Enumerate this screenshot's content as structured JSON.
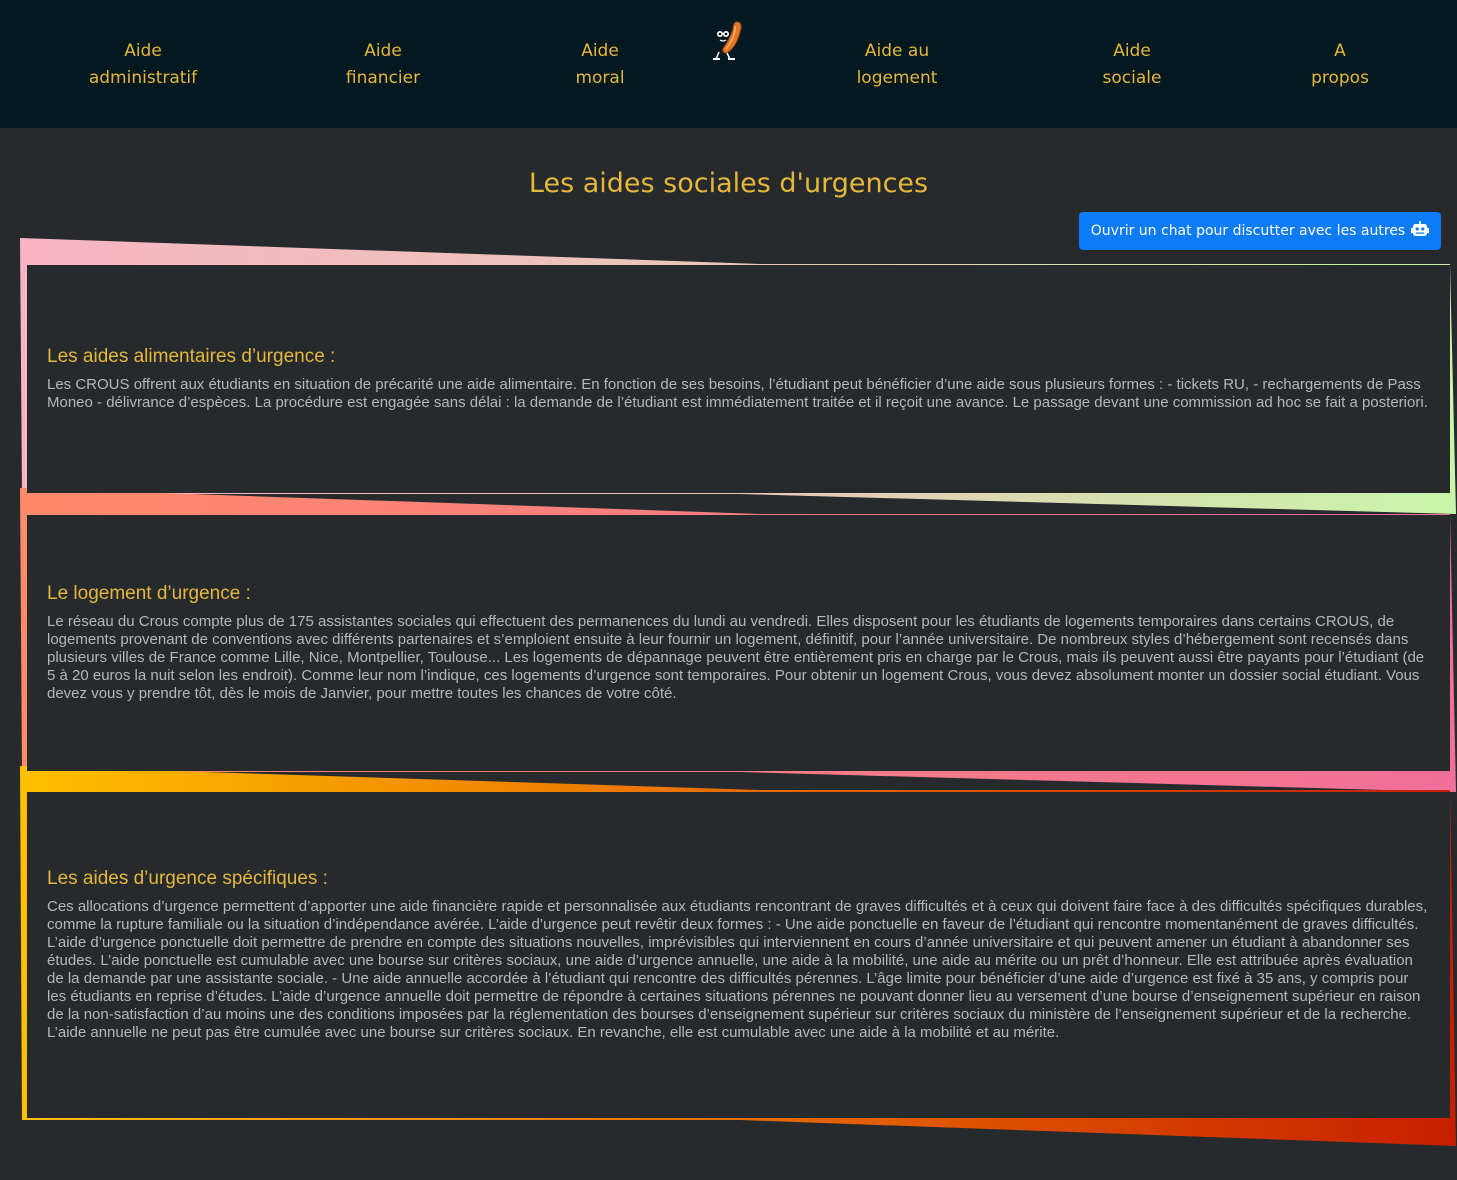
{
  "nav": {
    "items": [
      {
        "line1": "Aide",
        "line2": "administratif"
      },
      {
        "line1": "Aide",
        "line2": "financier"
      },
      {
        "line1": "Aide",
        "line2": "moral"
      },
      {
        "line1": "Aide au",
        "line2": "logement"
      },
      {
        "line1": "Aide",
        "line2": "sociale"
      },
      {
        "line1": "A",
        "line2": "propos"
      }
    ],
    "logo_icon": "sausage-mascot-icon"
  },
  "main": {
    "title": "Les aides sociales d'urgences",
    "chat_button_label": "Ouvrir un chat pour discutter avec les autres",
    "chat_button_icon": "robot-icon",
    "sections": [
      {
        "heading": "Les aides alimentaires d’urgence :",
        "text": "Les CROUS offrent aux étudiants en situation de précarité une aide alimentaire. En fonction de ses besoins, l’étudiant peut bénéficier d’une aide sous plusieurs formes : - tickets RU, - rechargements de Pass Moneo - délivrance d’espèces. La procédure est engagée sans délai : la demande de l’étudiant est immédiatement traitée et il reçoit une avance. Le passage devant une commission ad hoc se fait a posteriori."
      },
      {
        "heading": "Le logement d’urgence :",
        "text": "Le réseau du Crous compte plus de 175 assistantes sociales qui effectuent des permanences du lundi au vendredi. Elles disposent pour les étudiants de logements temporaires dans certains CROUS, de logements provenant de conventions avec différents partenaires et s’emploient ensuite à leur fournir un logement, définitif, pour l’année universitaire. De nombreux styles d’hébergement sont recensés dans plusieurs villes de France comme Lille, Nice, Montpellier, Toulouse... Les logements de dépannage peuvent être entièrement pris en charge par le Crous, mais ils peuvent aussi être payants pour l’étudiant (de 5 à 20 euros la nuit selon les endroit). Comme leur nom l’indique, ces logements d’urgence sont temporaires. Pour obtenir un logement Crous, vous devez absolument monter un dossier social étudiant. Vous devez vous y prendre tôt, dès le mois de Janvier, pour mettre toutes les chances de votre côté."
      },
      {
        "heading": "Les aides d’urgence spécifiques :",
        "text": "Ces allocations d’urgence permettent d’apporter une aide financière rapide et personnalisée aux étudiants rencontrant de graves difficultés et à ceux qui doivent faire face à des difficultés spécifiques durables, comme la rupture familiale ou la situation d’indépendance avérée. L’aide d’urgence peut revêtir deux formes : - Une aide ponctuelle en faveur de l’étudiant qui rencontre momentanément de graves difficultés. L’aide d’urgence ponctuelle doit permettre de prendre en compte des situations nouvelles, imprévisibles qui interviennent en cours d’année universitaire et qui peuvent amener un étudiant à abandonner ses études. L’aide ponctuelle est cumulable avec une bourse sur critères sociaux, une aide d’urgence annuelle, une aide à la mobilité, une aide au mérite ou un prêt d’honneur. Elle est attribuée après évaluation de la demande par une assistante sociale. - Une aide annuelle accordée à l’étudiant qui rencontre des difficultés pérennes. L’âge limite pour bénéficier d’une aide d’urgence est fixé à 35 ans, y compris pour les étudiants en reprise d’études. L’aide d’urgence annuelle doit permettre de répondre à certaines situations pérennes ne pouvant donner lieu au versement d’une bourse d’enseignement supérieur en raison de la non-satisfaction d’au moins une des conditions imposées par la réglementation des bourses d’enseignement supérieur sur critères sociaux du ministère de l’enseignement supérieur et de la recherche. L’aide annuelle ne peut pas être cumulée avec une bourse sur critères sociaux. En revanche, elle est cumulable avec une aide à la mobilité et au mérite."
      }
    ]
  },
  "colors": {
    "nav_bg": "#041820",
    "page_bg": "#262a2c",
    "accent": "#e5b73b",
    "body_text": "#b4b8bb",
    "button_bg": "#0d7bf5",
    "card1_gradient": [
      "#f9b4c4",
      "#c8f5a8"
    ],
    "card2_gradient": [
      "#ff8a6a",
      "#f0709a"
    ],
    "card3_gradient": [
      "#ffc000",
      "#c81e00"
    ]
  }
}
